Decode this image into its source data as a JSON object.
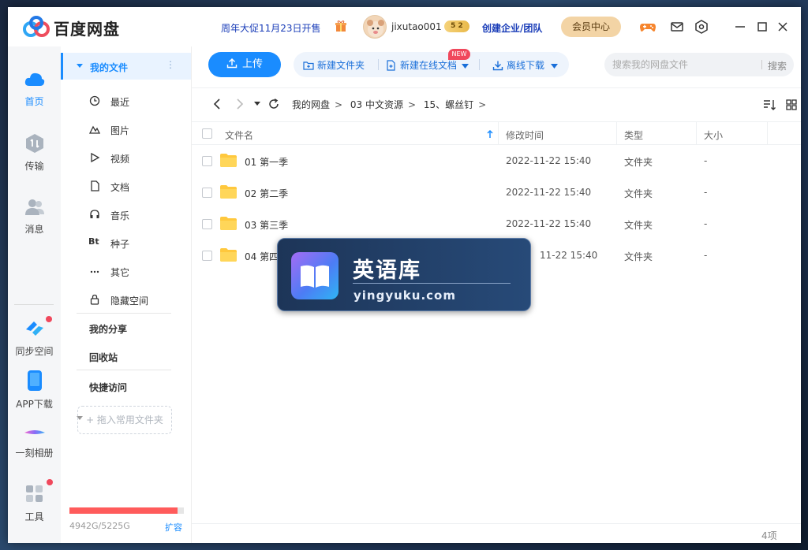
{
  "app": {
    "title": "百度网盘"
  },
  "titlebar": {
    "promo": "周年大促11月23日开售",
    "username": "jixutao001",
    "vip_level": "5 2",
    "enterprise": "创建企业/团队",
    "member_center": "会员中心",
    "icons": [
      "gift-icon",
      "game-icon",
      "mail-icon",
      "settings-icon",
      "minimize-icon",
      "maximize-icon",
      "close-icon"
    ]
  },
  "leftnav": [
    {
      "label": "首页",
      "icon": "cloud-home-icon",
      "active": true
    },
    {
      "label": "传输",
      "icon": "transfer-icon"
    },
    {
      "label": "消息",
      "icon": "contacts-icon"
    },
    {
      "label": "同步空间",
      "icon": "sync-icon",
      "dot": true
    },
    {
      "label": "APP下载",
      "icon": "phone-icon"
    },
    {
      "label": "一刻相册",
      "icon": "album-icon"
    },
    {
      "label": "工具",
      "icon": "tools-icon",
      "dot": true
    }
  ],
  "sidebar": {
    "my_files": "我的文件",
    "more": "⋮",
    "categories": [
      "最近",
      "图片",
      "视频",
      "文档",
      "音乐",
      "种子",
      "其它",
      "隐藏空间"
    ],
    "bt_glyph": "Bt",
    "my_share": "我的分享",
    "recycle": "回收站",
    "quick_access": "快捷访问",
    "drop_hint": "+ 拖入常用文件夹",
    "quota_text": "4942G/5225G",
    "quota_used_fraction": 0.946,
    "expand": "扩容"
  },
  "toolbar": {
    "upload": "上传",
    "new_folder": "新建文件夹",
    "new_online_doc": "新建在线文档",
    "new_badge": "NEW",
    "offline_download": "离线下载",
    "search_placeholder": "搜索我的网盘文件",
    "search_button": "搜索"
  },
  "breadcrumb": [
    "我的网盘",
    "03 中文资源",
    "15、螺丝钉"
  ],
  "breadcrumb_sep": ">",
  "table": {
    "headers": {
      "name": "文件名",
      "modified": "修改时间",
      "type": "类型",
      "size": "大小"
    },
    "rows": [
      {
        "name": "01 第一季",
        "modified": "2022-11-22 15:40",
        "type": "文件夹",
        "size": "-"
      },
      {
        "name": "02 第二季",
        "modified": "2022-11-22 15:40",
        "type": "文件夹",
        "size": "-"
      },
      {
        "name": "03 第三季",
        "modified": "2022-11-22 15:40",
        "type": "文件夹",
        "size": "-"
      },
      {
        "name": "04 第四",
        "modified": "11-22 15:40",
        "type": "文件夹",
        "size": "-"
      }
    ],
    "count": "4项"
  },
  "watermark": {
    "title": "英语库",
    "url": "yingyuku.com"
  },
  "colors": {
    "accent": "#1a8cff",
    "quota": "#ff5b5b",
    "badge": "#f0485c"
  }
}
